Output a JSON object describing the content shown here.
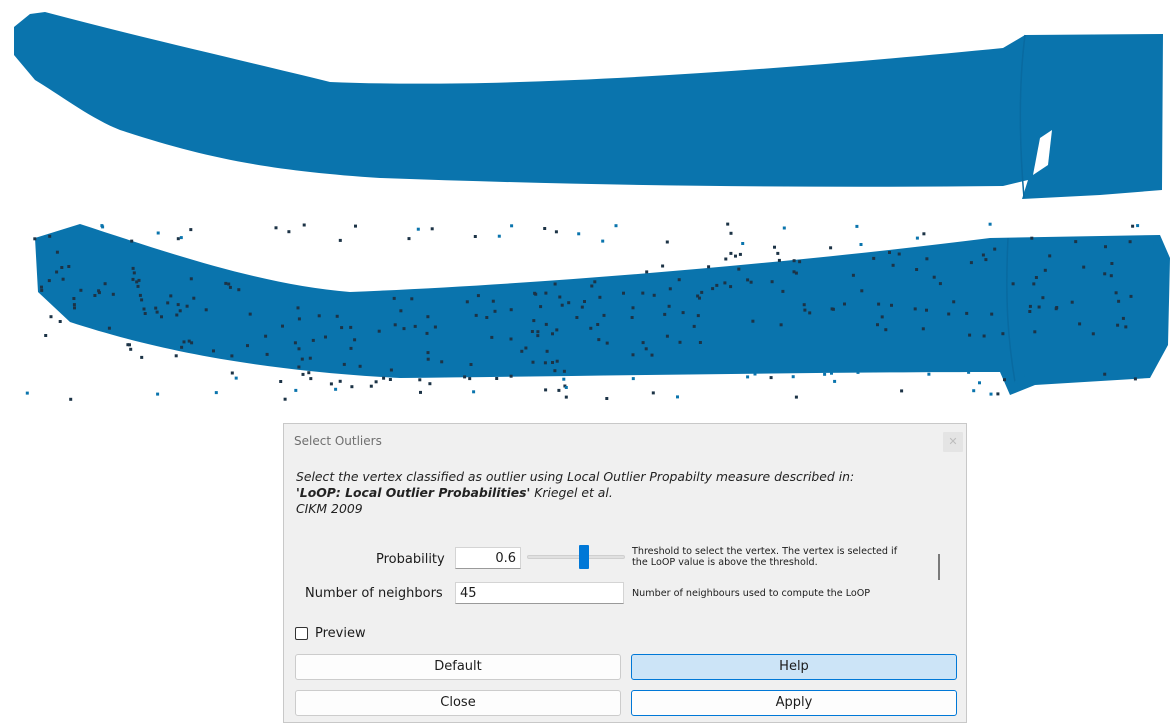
{
  "viewport": {
    "cloud_color": "#0a74ad",
    "outlier_color": "#1c3346"
  },
  "dialog": {
    "title": "Select Outliers",
    "close_icon": "close-icon",
    "description": {
      "line1": "Select the vertex classified as outlier using Local Outlier Propabilty measure described in:",
      "paper_title": "'LoOP: Local Outlier Probabilities'",
      "authors": " Kriegel et al.",
      "venue": "CIKM 2009"
    },
    "probability": {
      "label": "Probability",
      "value": "0.6",
      "slider_fraction": 0.6,
      "help_line1": "Threshold to select the vertex. The vertex is selected if",
      "help_line2": "the LoOP value is above the threshold."
    },
    "neighbors": {
      "label": "Number of neighbors",
      "value": "45",
      "help": "Number of neighbours used to compute the LoOP"
    },
    "preview": {
      "label": "Preview",
      "checked": false
    },
    "buttons": {
      "default": "Default",
      "help": "Help",
      "close": "Close",
      "apply": "Apply"
    },
    "accent_color": "#0078d7"
  }
}
